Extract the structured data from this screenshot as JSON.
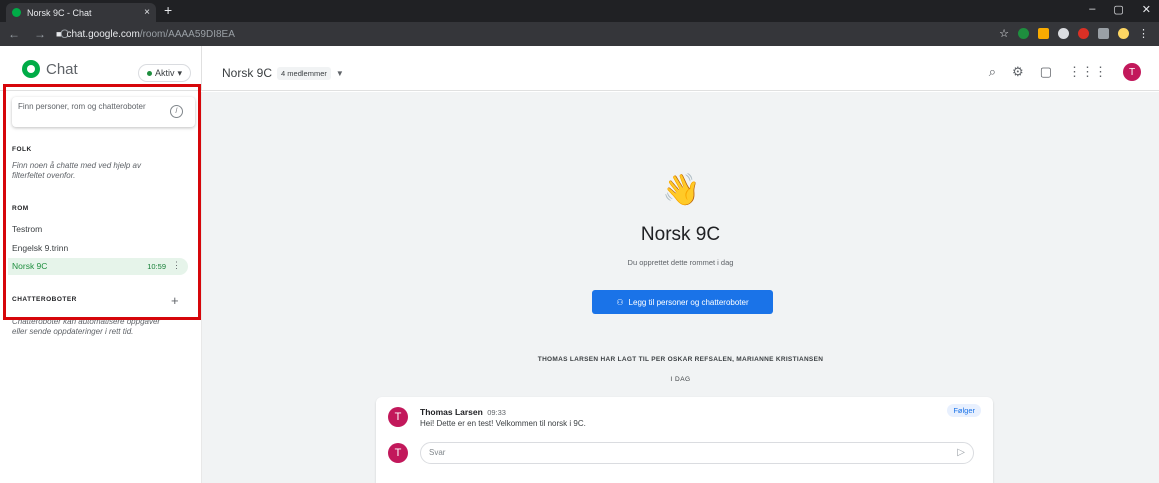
{
  "browser": {
    "tab_title": "Norsk 9C - Chat",
    "tab_close": "×",
    "new_tab": "+",
    "url_host": "chat.google.com",
    "url_path": "/room/AAAA59DI8EA",
    "window_controls": [
      "–",
      "▢",
      "✕"
    ]
  },
  "app": {
    "logo_text": "Chat",
    "status": "Aktiv",
    "room_title": "Norsk 9C",
    "members": "4 medlemmer"
  },
  "sidebar": {
    "search_placeholder": "Finn personer, rom og chatteroboter",
    "search_shortcut": "/",
    "people_header": "FOLK",
    "people_hint": "Finn noen å chatte med ved hjelp av filterfeltet ovenfor.",
    "rooms_header": "ROM",
    "rooms": [
      {
        "name": "Testrom"
      },
      {
        "name": "Engelsk 9.trinn"
      },
      {
        "name": "Norsk 9C",
        "time": "10:59"
      }
    ],
    "bots_header": "CHATTEROBOTER",
    "bots_hint": "Chatteroboter kan automatisere oppgaver eller sende oppdateringer i rett tid."
  },
  "main": {
    "title": "Norsk 9C",
    "subtitle": "Du opprettet dette rommet i dag",
    "add_button": "Legg til personer og chatteroboter",
    "system_message": "THOMAS LARSEN HAR LAGT TIL PER OSKAR REFSALEN, MARIANNE KRISTIANSEN",
    "date_divider": "I DAG",
    "message": {
      "avatar_initial": "T",
      "author": "Thomas Larsen",
      "time": "09:33",
      "text": "Hei! Dette er en test! Velkommen til norsk i 9C.",
      "follow_label": "Følger"
    },
    "reply_avatar_initial": "T",
    "reply_placeholder": "Svar"
  },
  "user": {
    "initial": "T"
  },
  "colors": {
    "accent_blue": "#1a73e8",
    "chat_green": "#00ac47",
    "annotation_red": "#d6060a",
    "avatar_pink": "#c2185b"
  }
}
